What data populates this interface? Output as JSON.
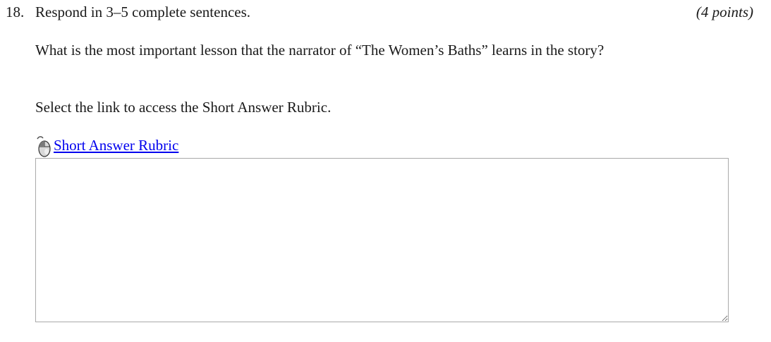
{
  "question": {
    "number": "18.",
    "instruction": "Respond in 3–5 complete sentences.",
    "points": "(4 points)",
    "prompt": "What is the most important lesson that the narrator of “The Women’s Baths” learns in the story?",
    "link_note": "Select the link to access the Short Answer Rubric."
  },
  "rubric": {
    "icon": "mouse-click-icon",
    "label": "Short Answer Rubric"
  },
  "answer": {
    "value": "",
    "placeholder": ""
  }
}
